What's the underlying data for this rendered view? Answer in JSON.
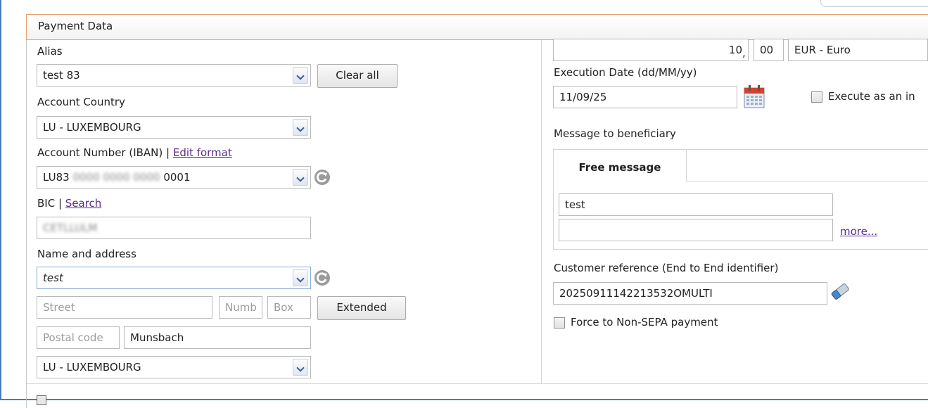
{
  "panel": {
    "title": "Payment Data"
  },
  "left": {
    "alias_label": "Alias",
    "alias_value": "test 83",
    "clear_all_label": "Clear all",
    "account_country_label": "Account Country",
    "account_country_value": "LU - LUXEMBOURG",
    "iban_label": "Account Number (IBAN) | ",
    "iban_edit_link": "Edit format",
    "iban_prefix": "LU83",
    "iban_blurred": "0000 0000 0000",
    "iban_suffix": "0001",
    "bic_label": "BIC | ",
    "bic_search_link": "Search",
    "bic_value_blurred": "CETLLULM",
    "name_address_label": "Name and address",
    "name_value": "test",
    "street_placeholder": "Street",
    "number_placeholder": "Numb",
    "box_placeholder": "Box",
    "extended_label": "Extended",
    "postal_placeholder": "Postal code",
    "city_value": "Munsbach",
    "address_country_value": "LU - LUXEMBOURG"
  },
  "right": {
    "amount_integer": "10",
    "amount_separator": ",",
    "amount_decimal": "00",
    "currency_value": "EUR - Euro",
    "execution_date_label": "Execution Date (dd/MM/yy)",
    "execution_date_value": "11/09/25",
    "execute_instant_label": "Execute as an in",
    "message_label": "Message to beneficiary",
    "tab_free_message": "Free message",
    "message_line1": "test",
    "message_line2": "",
    "more_link": "more...",
    "customer_ref_label": "Customer reference (End to End identifier)",
    "customer_ref_value": "20250911142213532OMULTI",
    "force_non_sepa_label": "Force to Non-SEPA payment"
  },
  "colors": {
    "header_border": "#e8a06a",
    "link": "#5a2a8a",
    "frame": "#4a7ab8"
  },
  "icons": [
    "chevron-down-icon",
    "refresh-icon",
    "calendar-icon",
    "eraser-icon"
  ]
}
